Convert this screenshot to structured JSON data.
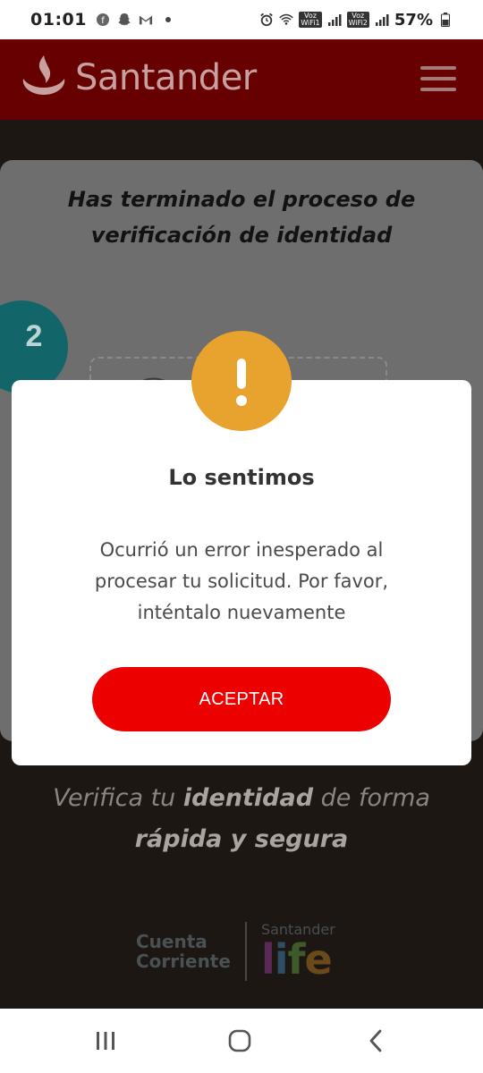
{
  "status_bar": {
    "time": "01:01",
    "battery_text": "57%",
    "icons": [
      "facebook-icon",
      "snapchat-icon",
      "gmail-icon",
      "dot-icon",
      "alarm-icon",
      "wifi-icon",
      "voz-wifi-1-icon",
      "signal-1-icon",
      "voz-wifi-2-icon",
      "signal-2-icon",
      "battery-icon"
    ],
    "voz_label": "Voz",
    "wifi1_label": "WiFi1",
    "wifi2_label": "WiFi2"
  },
  "header": {
    "brand": "Santander",
    "brand_color": "#ec0000",
    "menu_icon": "hamburger-icon"
  },
  "background_page": {
    "card_title": "Has terminado el proceso de verificación de identidad",
    "step_number": "2",
    "tagline_part1": "Verifica tu ",
    "tagline_bold1": "identidad",
    "tagline_part2": " de forma ",
    "tagline_bold2": "rápida y segura",
    "logo_cuenta_line1": "Cuenta",
    "logo_cuenta_line2": "Corriente",
    "logo_life_small": "Santander",
    "logo_life_big": "life"
  },
  "modal": {
    "icon": "exclamation-icon",
    "icon_color": "#e8a22e",
    "title": "Lo sentimos",
    "message": "Ocurrió un error inesperado al procesar tu solicitud. Por favor, inténtalo nuevamente",
    "accept_label": "ACEPTAR",
    "accept_color": "#ec0000"
  },
  "nav_bar": {
    "buttons": [
      "recent-apps-icon",
      "home-icon",
      "back-icon"
    ]
  }
}
